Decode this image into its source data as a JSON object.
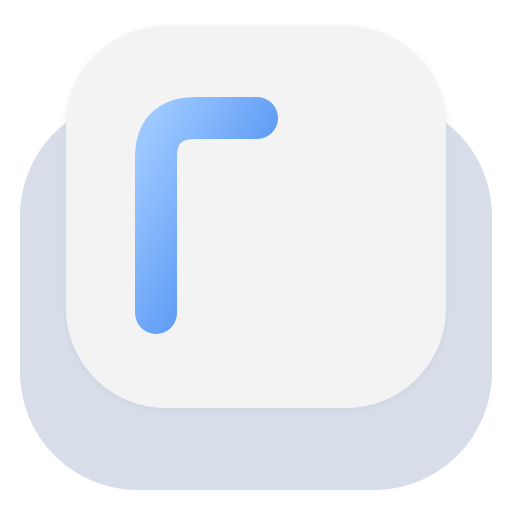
{
  "app_icon": {
    "letter": "F",
    "icon_name": "font-speaker-app-icon",
    "speaker_icon_name": "speaker-volume-icon",
    "colors": {
      "page_background": "#ffffff",
      "back_key": "#d7dee9",
      "front_key": "#f3f3f4",
      "glyph_gradient_start": "#9cc8ff",
      "glyph_gradient_end": "#3d84f0"
    }
  }
}
